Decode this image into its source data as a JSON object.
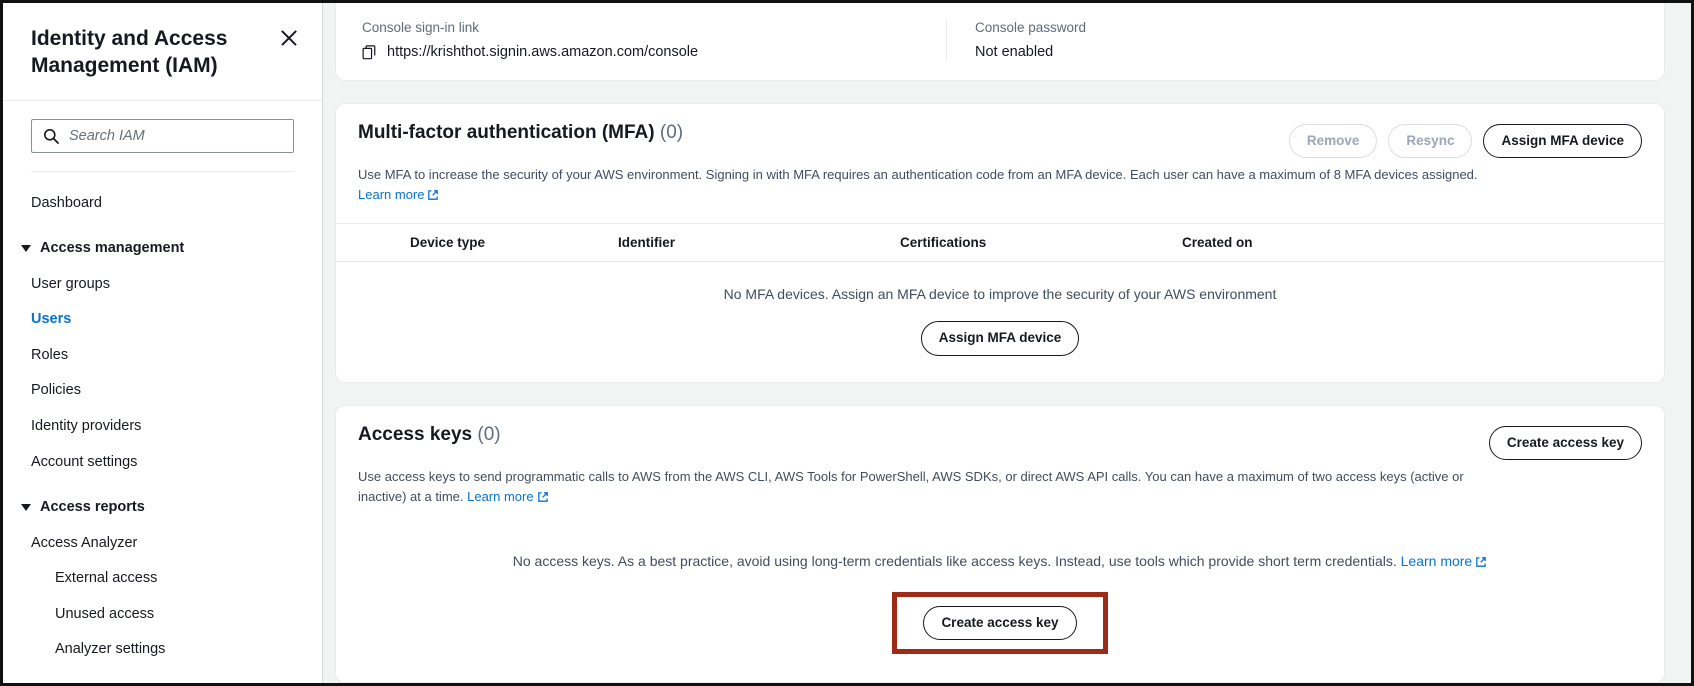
{
  "sidebar": {
    "title": "Identity and Access Management (IAM)",
    "close_icon": "close-icon",
    "search": {
      "placeholder": "Search IAM",
      "value": "",
      "icon": "search-icon"
    },
    "items": [
      {
        "label": "Dashboard",
        "type": "item",
        "selected": false
      },
      {
        "label": "Access management",
        "type": "group",
        "selected": false
      },
      {
        "label": "User groups",
        "type": "item",
        "selected": false
      },
      {
        "label": "Users",
        "type": "item",
        "selected": true
      },
      {
        "label": "Roles",
        "type": "item",
        "selected": false
      },
      {
        "label": "Policies",
        "type": "item",
        "selected": false
      },
      {
        "label": "Identity providers",
        "type": "item",
        "selected": false
      },
      {
        "label": "Account settings",
        "type": "item",
        "selected": false
      },
      {
        "label": "Access reports",
        "type": "group",
        "selected": false
      },
      {
        "label": "Access Analyzer",
        "type": "item",
        "selected": false
      },
      {
        "label": "External access",
        "type": "subitem",
        "selected": false
      },
      {
        "label": "Unused access",
        "type": "subitem",
        "selected": false
      },
      {
        "label": "Analyzer settings",
        "type": "subitem",
        "selected": false
      }
    ]
  },
  "summary": {
    "signin_link_label": "Console sign-in link",
    "signin_link_value": "https://krishthot.signin.aws.amazon.com/console",
    "copy_icon": "copy-icon",
    "console_password_label": "Console password",
    "console_password_value": "Not enabled"
  },
  "mfa": {
    "title": "Multi-factor authentication (MFA)",
    "count": "(0)",
    "description_1": "Use MFA to increase the security of your AWS environment. Signing in with MFA requires an authentication code from an MFA device. Each user can have a maximum of 8 MFA devices assigned. ",
    "learn_more": "Learn more",
    "buttons": {
      "remove": "Remove",
      "resync": "Resync",
      "assign": "Assign MFA device"
    },
    "columns": [
      "Device type",
      "Identifier",
      "Certifications",
      "Created on"
    ],
    "empty_text": "No MFA devices. Assign an MFA device to improve the security of your AWS environment",
    "empty_button": "Assign MFA device"
  },
  "access_keys": {
    "title": "Access keys",
    "count": "(0)",
    "description_1": "Use access keys to send programmatic calls to AWS from the AWS CLI, AWS Tools for PowerShell, AWS SDKs, or direct AWS API calls. You can have a maximum of two access keys (active or inactive) at a time. ",
    "learn_more": "Learn more",
    "create_button": "Create access key",
    "empty_text": "No access keys. As a best practice, avoid using long-term credentials like access keys. Instead, use tools which provide short term credentials. ",
    "empty_learn_more": "Learn more",
    "empty_button": "Create access key"
  },
  "colors": {
    "link": "#0972d3",
    "highlight": "#9e2a18",
    "text": "#16191f",
    "muted": "#5f6b7a",
    "background": "#f2f3f3"
  }
}
